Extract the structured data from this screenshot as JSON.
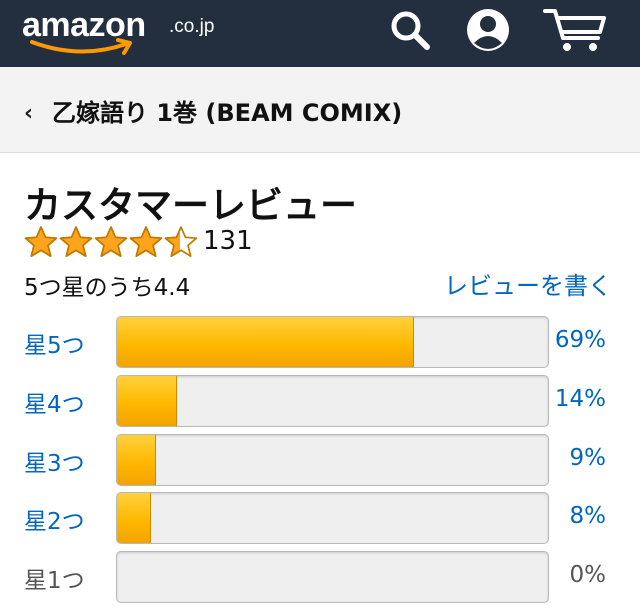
{
  "header": {
    "logo_text": "amazon",
    "logo_tld": ".co.jp",
    "icons": [
      "search-icon",
      "account-icon",
      "cart-icon"
    ],
    "bg_color": "#232f3e",
    "logo_smile_color": "#ff9900"
  },
  "breadcrumb": {
    "back_glyph": "‹",
    "title": "乙嫁語り 1巻 (BEAM COMIX)"
  },
  "reviews": {
    "heading": "カスタマーレビュー",
    "average_rating": 4.4,
    "star_count": 5,
    "review_count": "131",
    "rating_text": "5つ星のうち4.4",
    "write_review_label": "レビューを書く",
    "histogram": [
      {
        "label": "星5つ",
        "percent_label": "69%",
        "percent": 69,
        "enabled": true
      },
      {
        "label": "星4つ",
        "percent_label": "14%",
        "percent": 14,
        "enabled": true
      },
      {
        "label": "星3つ",
        "percent_label": "9%",
        "percent": 9,
        "enabled": true
      },
      {
        "label": "星2つ",
        "percent_label": "8%",
        "percent": 8,
        "enabled": true
      },
      {
        "label": "星1つ",
        "percent_label": "0%",
        "percent": 0,
        "enabled": false
      }
    ],
    "link_color": "#0066c0",
    "star_color": "#ffa41c",
    "bar_fill_color": "#ffb800"
  }
}
